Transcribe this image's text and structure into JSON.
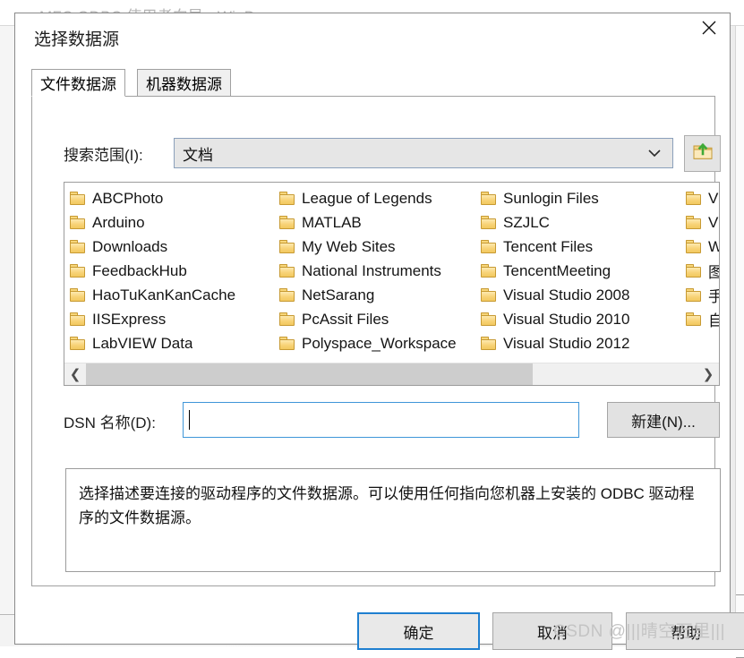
{
  "background_window": {
    "title": "MFC ODBC 使用者向导 - WinDemo"
  },
  "dialog": {
    "title": "选择数据源",
    "close_icon": "close-icon",
    "tabs": [
      {
        "label": "文件数据源",
        "active": true
      },
      {
        "label": "机器数据源",
        "active": false
      }
    ],
    "lookin": {
      "label": "搜索范围(I):",
      "value": "文档",
      "chevron_icon": "chevron-down-icon",
      "uplevel_icon": "folder-up-icon"
    },
    "filelist": {
      "columns": [
        [
          "ABCPhoto",
          "Arduino",
          "Downloads",
          "FeedbackHub",
          "HaoTuKanKanCache",
          "IISExpress",
          "LabVIEW Data"
        ],
        [
          "League of Legends",
          "MATLAB",
          "My Web Sites",
          "National Instruments",
          "NetSarang",
          "PcAssit Files",
          "Polyspace_Workspace"
        ],
        [
          "Sunlogin Files",
          "SZJLC",
          "Tencent Files",
          "TencentMeeting",
          "Visual Studio 2008",
          "Visual Studio 2010",
          "Visual Studio 2012"
        ],
        [
          "Visu",
          "Visu",
          "Win",
          "图形",
          "手机",
          "自定"
        ]
      ],
      "scroll_left_icon": "chevron-left-icon",
      "scroll_right_icon": "chevron-right-icon",
      "scroll_thumb_percent": 73
    },
    "dsn": {
      "label": "DSN 名称(D):",
      "value": "",
      "new_button_label": "新建(N)..."
    },
    "description": "选择描述要连接的驱动程序的文件数据源。可以使用任何指向您机器上安装的 ODBC 驱动程序的文件数据源。",
    "footer": {
      "ok_label": "确定",
      "cancel_label": "取消",
      "help_label": "帮助"
    }
  },
  "watermark": "CSDN @|||晴空万里|||",
  "colors": {
    "accent": "#1f7fd0",
    "focus_border": "#3f96d8",
    "folder": "#f2c85f",
    "dialog_border": "#8a8a8a"
  }
}
